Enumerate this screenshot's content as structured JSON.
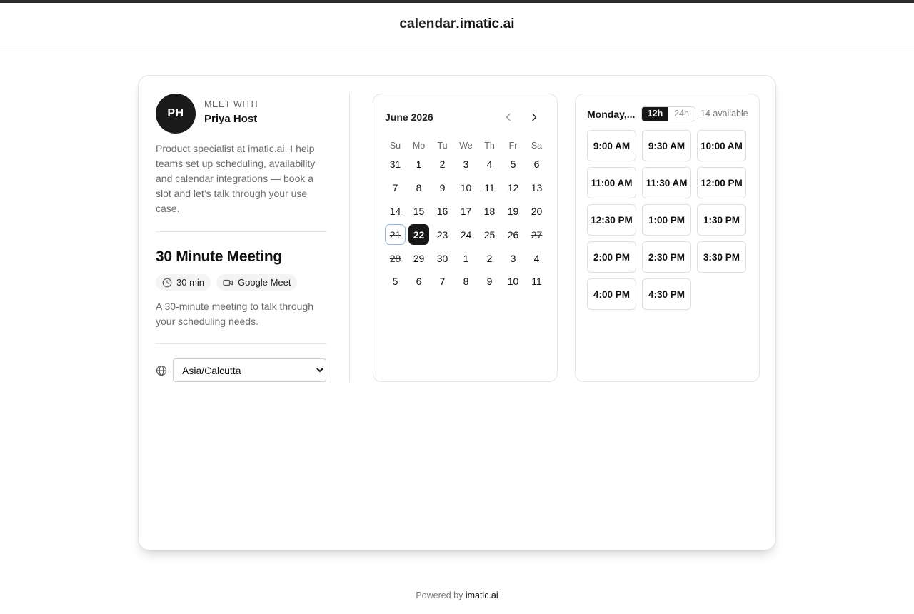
{
  "site": {
    "title_part1": "calendar",
    "title_part2": ".imatic.ai"
  },
  "host": {
    "initials": "PH",
    "meet_with_label": "MEET WITH",
    "name": "Priya Host",
    "bio": "Product specialist at imatic.ai. I help teams set up scheduling, availability and calendar integrations — book a slot and let’s talk through your use case."
  },
  "event": {
    "title": "30 Minute Meeting",
    "duration": "30 min",
    "location": "Google Meet",
    "description": "A 30-minute meeting to talk through your scheduling needs."
  },
  "timezone": {
    "selected": "Asia/Calcutta",
    "icon": "globe-icon"
  },
  "calendar": {
    "month_label": "June 2026",
    "weekdays": [
      "Su",
      "Mo",
      "Tu",
      "We",
      "Th",
      "Fr",
      "Sa"
    ],
    "weeks": [
      [
        {
          "d": "31"
        },
        {
          "d": "1"
        },
        {
          "d": "2"
        },
        {
          "d": "3"
        },
        {
          "d": "4"
        },
        {
          "d": "5"
        },
        {
          "d": "6"
        }
      ],
      [
        {
          "d": "7"
        },
        {
          "d": "8"
        },
        {
          "d": "9"
        },
        {
          "d": "10"
        },
        {
          "d": "11"
        },
        {
          "d": "12"
        },
        {
          "d": "13"
        }
      ],
      [
        {
          "d": "14"
        },
        {
          "d": "15"
        },
        {
          "d": "16"
        },
        {
          "d": "17"
        },
        {
          "d": "18"
        },
        {
          "d": "19"
        },
        {
          "d": "20"
        }
      ],
      [
        {
          "d": "21",
          "state": "today-disabled"
        },
        {
          "d": "22",
          "state": "selected"
        },
        {
          "d": "23"
        },
        {
          "d": "24"
        },
        {
          "d": "25"
        },
        {
          "d": "26"
        },
        {
          "d": "27",
          "state": "disabled"
        }
      ],
      [
        {
          "d": "28",
          "state": "disabled"
        },
        {
          "d": "29"
        },
        {
          "d": "30"
        },
        {
          "d": "1"
        },
        {
          "d": "2"
        },
        {
          "d": "3"
        },
        {
          "d": "4"
        }
      ],
      [
        {
          "d": "5"
        },
        {
          "d": "6"
        },
        {
          "d": "7"
        },
        {
          "d": "8"
        },
        {
          "d": "9"
        },
        {
          "d": "10"
        },
        {
          "d": "11"
        }
      ]
    ]
  },
  "slots": {
    "day_label": "Monday,...",
    "format_12h": "12h",
    "format_24h": "24h",
    "active_format": "12h",
    "available_count": "14 available",
    "times": [
      "9:00 AM",
      "9:30 AM",
      "10:00 AM",
      "11:00 AM",
      "11:30 AM",
      "12:00 PM",
      "12:30 PM",
      "1:00 PM",
      "1:30 PM",
      "2:00 PM",
      "2:30 PM",
      "3:30 PM",
      "4:00 PM",
      "4:30 PM"
    ]
  },
  "footer": {
    "prefix": "Powered by ",
    "brand": "imatic.ai"
  },
  "colors": {
    "accent": "#171717",
    "today_outline": "#9ab4d8",
    "border": "#e4e4e4"
  }
}
